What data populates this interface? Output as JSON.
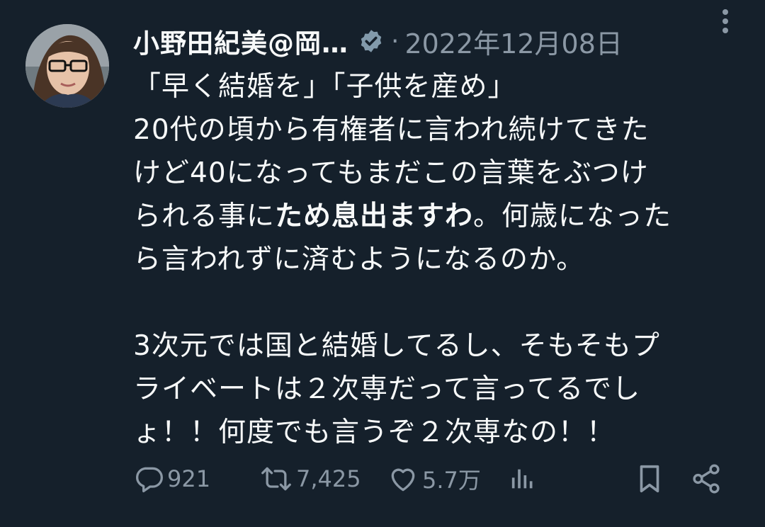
{
  "author": {
    "display_name": "小野田紀美@岡…",
    "verified_icon": "verified-badge-icon",
    "separator": "·",
    "date": "2022年12月08日"
  },
  "tweet": {
    "line1": "「早く結婚を」「子供を産め」",
    "line2": "20代の頃から有権者に言われ続けてきた",
    "line3": "けど40になってもまだこの言葉をぶつけ",
    "line4_pre": "られる事に",
    "line4_bold": "ため息出ますわ",
    "line4_post": "。何歳になった",
    "line5": "ら言われずに済むようになるのか。",
    "line6": "3次元では国と結婚してるし、そもそもプ",
    "line7": "ライベートは２次専だって言ってるでし",
    "line8": "ょ！！何度でも言うぞ２次専なの！！"
  },
  "actions": {
    "replies": "921",
    "retweets": "7,425",
    "likes": "5.7万"
  },
  "icons": {
    "reply": "reply-icon",
    "retweet": "retweet-icon",
    "like": "heart-icon",
    "views": "bar-chart-icon",
    "bookmark": "bookmark-icon",
    "share": "share-icon",
    "more": "more-vertical-icon"
  },
  "colors": {
    "background": "#15202b",
    "text": "#f7f9f9",
    "muted": "#8b98a5"
  }
}
